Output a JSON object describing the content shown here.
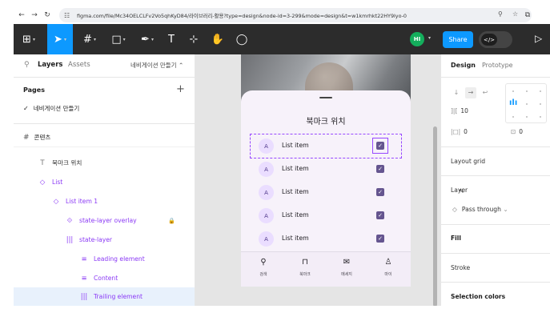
{
  "browser": {
    "url": "figma.com/file/Mc34OELCLFv2Vo5qhKyD84/라이브러리-활용?type=design&node-id=3-299&mode=design&t=w1kmrhkt22HY9lyo-0",
    "back_icon": "arrow-left-icon",
    "forward_icon": "arrow-right-icon",
    "reload_icon": "reload-icon"
  },
  "toolbar": {
    "avatar_initials": "HI",
    "share_label": "Share",
    "dev_mode_label": "</>"
  },
  "left_panel": {
    "tabs": {
      "layers": "Layers",
      "assets": "Assets"
    },
    "page_selector": "네비게이션 만들기",
    "pages_title": "Pages",
    "pages": [
      {
        "label": "네비게이션 만들기",
        "current": true
      }
    ],
    "frame_name": "콘텐츠",
    "layers": [
      {
        "label": "북마크 위치",
        "icon": "text-icon",
        "style": "plain"
      },
      {
        "label": "List",
        "icon": "component-instance-icon",
        "style": "component"
      },
      {
        "label": "List item 1",
        "icon": "component-instance-icon",
        "style": "component"
      },
      {
        "label": "state-layer overlay",
        "icon": "component-set-icon",
        "style": "component",
        "locked": true
      },
      {
        "label": "state-layer",
        "icon": "auto-layout-horizontal-icon",
        "style": "component"
      },
      {
        "label": "Leading element",
        "icon": "slot-icon",
        "style": "component"
      },
      {
        "label": "Content",
        "icon": "slot-icon",
        "style": "component"
      },
      {
        "label": "Trailing element",
        "icon": "auto-layout-horizontal-icon",
        "style": "component",
        "selected": true
      }
    ]
  },
  "canvas": {
    "sheet_title": "북마크 위치",
    "list_items": [
      {
        "avatar": "A",
        "label": "List item",
        "checked": true
      },
      {
        "avatar": "A",
        "label": "List item",
        "checked": true
      },
      {
        "avatar": "A",
        "label": "List item",
        "checked": true
      },
      {
        "avatar": "A",
        "label": "List item",
        "checked": true
      },
      {
        "avatar": "A",
        "label": "List item",
        "checked": true
      }
    ],
    "bottom_nav": [
      {
        "label": "검색",
        "icon": "search-icon"
      },
      {
        "label": "북마크",
        "icon": "bookmark-icon"
      },
      {
        "label": "메세지",
        "icon": "mail-icon"
      },
      {
        "label": "마이",
        "icon": "person-icon"
      }
    ]
  },
  "right_panel": {
    "tabs": {
      "design": "Design",
      "prototype": "Prototype"
    },
    "gap_value": "10",
    "padding_value": "0",
    "spacing_value": "0",
    "sections": {
      "layout_grid": "Layout grid",
      "layer": "Layer",
      "blend_mode": "Pass through",
      "fill": "Fill",
      "stroke": "Stroke",
      "selection_colors": "Selection colors"
    }
  },
  "colors": {
    "toolbar_bg": "#2c2c2c",
    "figma_blue": "#0d99ff",
    "component_purple": "#8a38f5",
    "checkbox": "#65558f",
    "avatar_bg": "#eaddff",
    "sheet_bg": "#f7f2fa"
  }
}
